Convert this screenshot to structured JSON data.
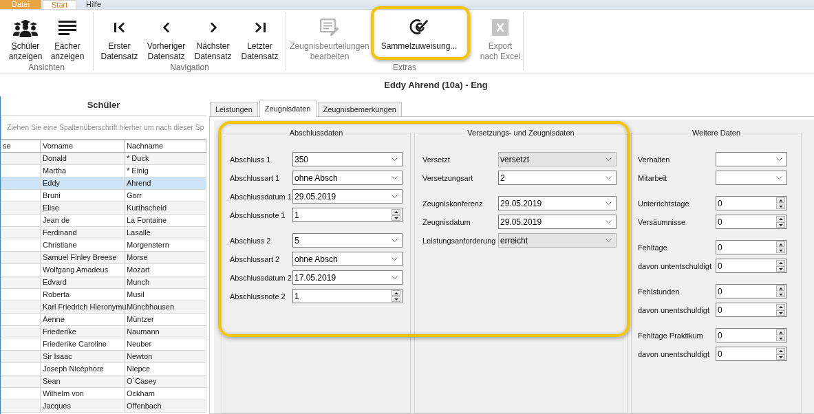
{
  "app_tabs": [
    {
      "kind": "file",
      "label": "Datei",
      "selected": false
    },
    {
      "kind": "tab",
      "label": "Start",
      "selected": true
    },
    {
      "kind": "tab",
      "label": "Hilfe",
      "selected": false
    }
  ],
  "ribbon": {
    "groups": [
      {
        "label": "Ansichten",
        "buttons": [
          {
            "label": "Schüler\nanzeigen",
            "mnemonic": true,
            "disabled": false,
            "highlighted": false
          },
          {
            "label": "Fächer\nanzeigen",
            "mnemonic": true,
            "disabled": false,
            "highlighted": false
          }
        ]
      },
      {
        "label": "Navigation",
        "buttons": [
          {
            "label": "Erster\nDatensatz",
            "mnemonic": false,
            "disabled": false,
            "highlighted": false
          },
          {
            "label": "Vorheriger\nDatensatz",
            "mnemonic": false,
            "disabled": false,
            "highlighted": false
          },
          {
            "label": "Nächster\nDatensatz",
            "mnemonic": false,
            "disabled": false,
            "highlighted": false
          },
          {
            "label": "Letzter\nDatensatz",
            "mnemonic": false,
            "disabled": false,
            "highlighted": false
          }
        ]
      },
      {
        "label": "Extras",
        "buttons": [
          {
            "label": "Zeugnisbeurteilungen\nbearbeiten",
            "mnemonic": false,
            "disabled": true,
            "highlighted": false
          },
          {
            "label": "Sammelzuweisung...",
            "mnemonic": false,
            "disabled": false,
            "highlighted": true
          },
          {
            "label": "Export\nnach Excel",
            "mnemonic": false,
            "disabled": true,
            "highlighted": false
          }
        ]
      }
    ]
  },
  "record_title": "Eddy Ahrend (10a) - Eng",
  "student_list": {
    "title": "Schüler",
    "group_hint": "Ziehen Sie eine Spaltenüberschrift hierher um nach dieser Sp",
    "columns": [
      "se",
      "Vorname",
      "Nachname"
    ],
    "rows": [
      {
        "first_name": "Donald",
        "last_name": "* Duck",
        "selected": false
      },
      {
        "first_name": "Martha",
        "last_name": "* Einig",
        "selected": false
      },
      {
        "first_name": "Eddy",
        "last_name": "Ahrend",
        "selected": true
      },
      {
        "first_name": "Bruni",
        "last_name": "Gorr",
        "selected": false
      },
      {
        "first_name": "Elise",
        "last_name": "Kurthscheid",
        "selected": false
      },
      {
        "first_name": "Jean de",
        "last_name": "La Fontaine",
        "selected": false
      },
      {
        "first_name": "Ferdinand",
        "last_name": "Lasalle",
        "selected": false
      },
      {
        "first_name": "Christiane",
        "last_name": "Morgenstern",
        "selected": false
      },
      {
        "first_name": "Samuel Finley Breese",
        "last_name": "Morse",
        "selected": false
      },
      {
        "first_name": "Wolfgang Amadeus",
        "last_name": "Mozart",
        "selected": false
      },
      {
        "first_name": "Edvard",
        "last_name": "Munch",
        "selected": false
      },
      {
        "first_name": "Roberta",
        "last_name": "Musil",
        "selected": false
      },
      {
        "first_name": "Karl Friedrich Hieronymu",
        "last_name": "Münchhausen",
        "selected": false
      },
      {
        "first_name": "Aenne",
        "last_name": "Müntzer",
        "selected": false
      },
      {
        "first_name": "Friederike",
        "last_name": "Naumann",
        "selected": false
      },
      {
        "first_name": "Friederike Caroline",
        "last_name": "Neuber",
        "selected": false
      },
      {
        "first_name": "Sir Isaac",
        "last_name": "Newton",
        "selected": false
      },
      {
        "first_name": "Joseph Nicéphore",
        "last_name": "Niepce",
        "selected": false
      },
      {
        "first_name": "Sean",
        "last_name": "O`Casey",
        "selected": false
      },
      {
        "first_name": "Wilhelm von",
        "last_name": "Ockham",
        "selected": false
      },
      {
        "first_name": "Jacques",
        "last_name": "Offenbach",
        "selected": false
      }
    ]
  },
  "detail": {
    "tabs": [
      {
        "label": "Leistungen",
        "selected": false
      },
      {
        "label": "Zeugnisdaten",
        "selected": true
      },
      {
        "label": "Zeugnisbemerkungen",
        "selected": false
      }
    ],
    "groups": [
      {
        "title": "Abschlussdaten",
        "highlighted": true,
        "sections": [
          [
            {
              "label": "Abschluss 1",
              "kind": "dropdown",
              "value": "350",
              "readonly": false
            },
            {
              "label": "Abschlussart 1",
              "kind": "dropdown",
              "value": "ohne Absch",
              "readonly": false
            },
            {
              "label": "Abschlussdatum 1",
              "kind": "dropdown",
              "value": "29.05.2019",
              "readonly": false
            },
            {
              "label": "Abschlussnote 1",
              "kind": "spinner",
              "value": "1",
              "readonly": false
            }
          ],
          [
            {
              "label": "Abschluss 2",
              "kind": "dropdown",
              "value": "5",
              "readonly": false
            },
            {
              "label": "Abschlussart 2",
              "kind": "dropdown",
              "value": "ohne Absch",
              "readonly": false
            },
            {
              "label": "Abschlussdatum 2",
              "kind": "dropdown",
              "value": "17.05.2019",
              "readonly": false
            },
            {
              "label": "Abschlussnote 2",
              "kind": "spinner",
              "value": "1",
              "readonly": false
            }
          ]
        ]
      },
      {
        "title": "Versetzungs- und Zeugnisdaten",
        "highlighted": true,
        "sections": [
          [
            {
              "label": "Versetzt",
              "kind": "dropdown",
              "value": "versetzt",
              "readonly": true
            },
            {
              "label": "Versetzungsart",
              "kind": "dropdown",
              "value": "2",
              "readonly": false
            }
          ],
          [
            {
              "label": "Zeugniskonferenz",
              "kind": "dropdown",
              "value": "29.05.2019",
              "readonly": false
            },
            {
              "label": "Zeugnisdatum",
              "kind": "dropdown",
              "value": "29.05.2019",
              "readonly": false
            },
            {
              "label": "Leistungsanforderung",
              "kind": "dropdown",
              "value": "erreicht",
              "readonly": true
            }
          ]
        ]
      },
      {
        "title": "Weitere Daten",
        "highlighted": false,
        "sections": [
          [
            {
              "label": "Verhalten",
              "kind": "dropdown",
              "readonly": false
            },
            {
              "label": "Mitarbeit",
              "kind": "dropdown",
              "readonly": false
            }
          ],
          [
            {
              "label": "Unterrichtstage",
              "kind": "spinner",
              "value": "0",
              "readonly": false
            },
            {
              "label": "Versäumnisse",
              "kind": "spinner",
              "value": "0",
              "readonly": false
            }
          ],
          [
            {
              "label": "Fehltage",
              "kind": "spinner",
              "value": "0",
              "readonly": false
            },
            {
              "label": "davon untentschuldigt",
              "kind": "spinner",
              "value": "0",
              "readonly": false
            }
          ],
          [
            {
              "label": "Fehlstunden",
              "kind": "spinner",
              "value": "0",
              "readonly": false
            },
            {
              "label": "davon unentschuldigt",
              "kind": "spinner",
              "value": "0",
              "readonly": false
            }
          ],
          [
            {
              "label": "Fehltage Praktikum",
              "kind": "spinner",
              "value": "0",
              "readonly": false
            },
            {
              "label": "davon unentschuldigt",
              "kind": "spinner",
              "value": "0",
              "readonly": false
            }
          ]
        ]
      }
    ]
  }
}
